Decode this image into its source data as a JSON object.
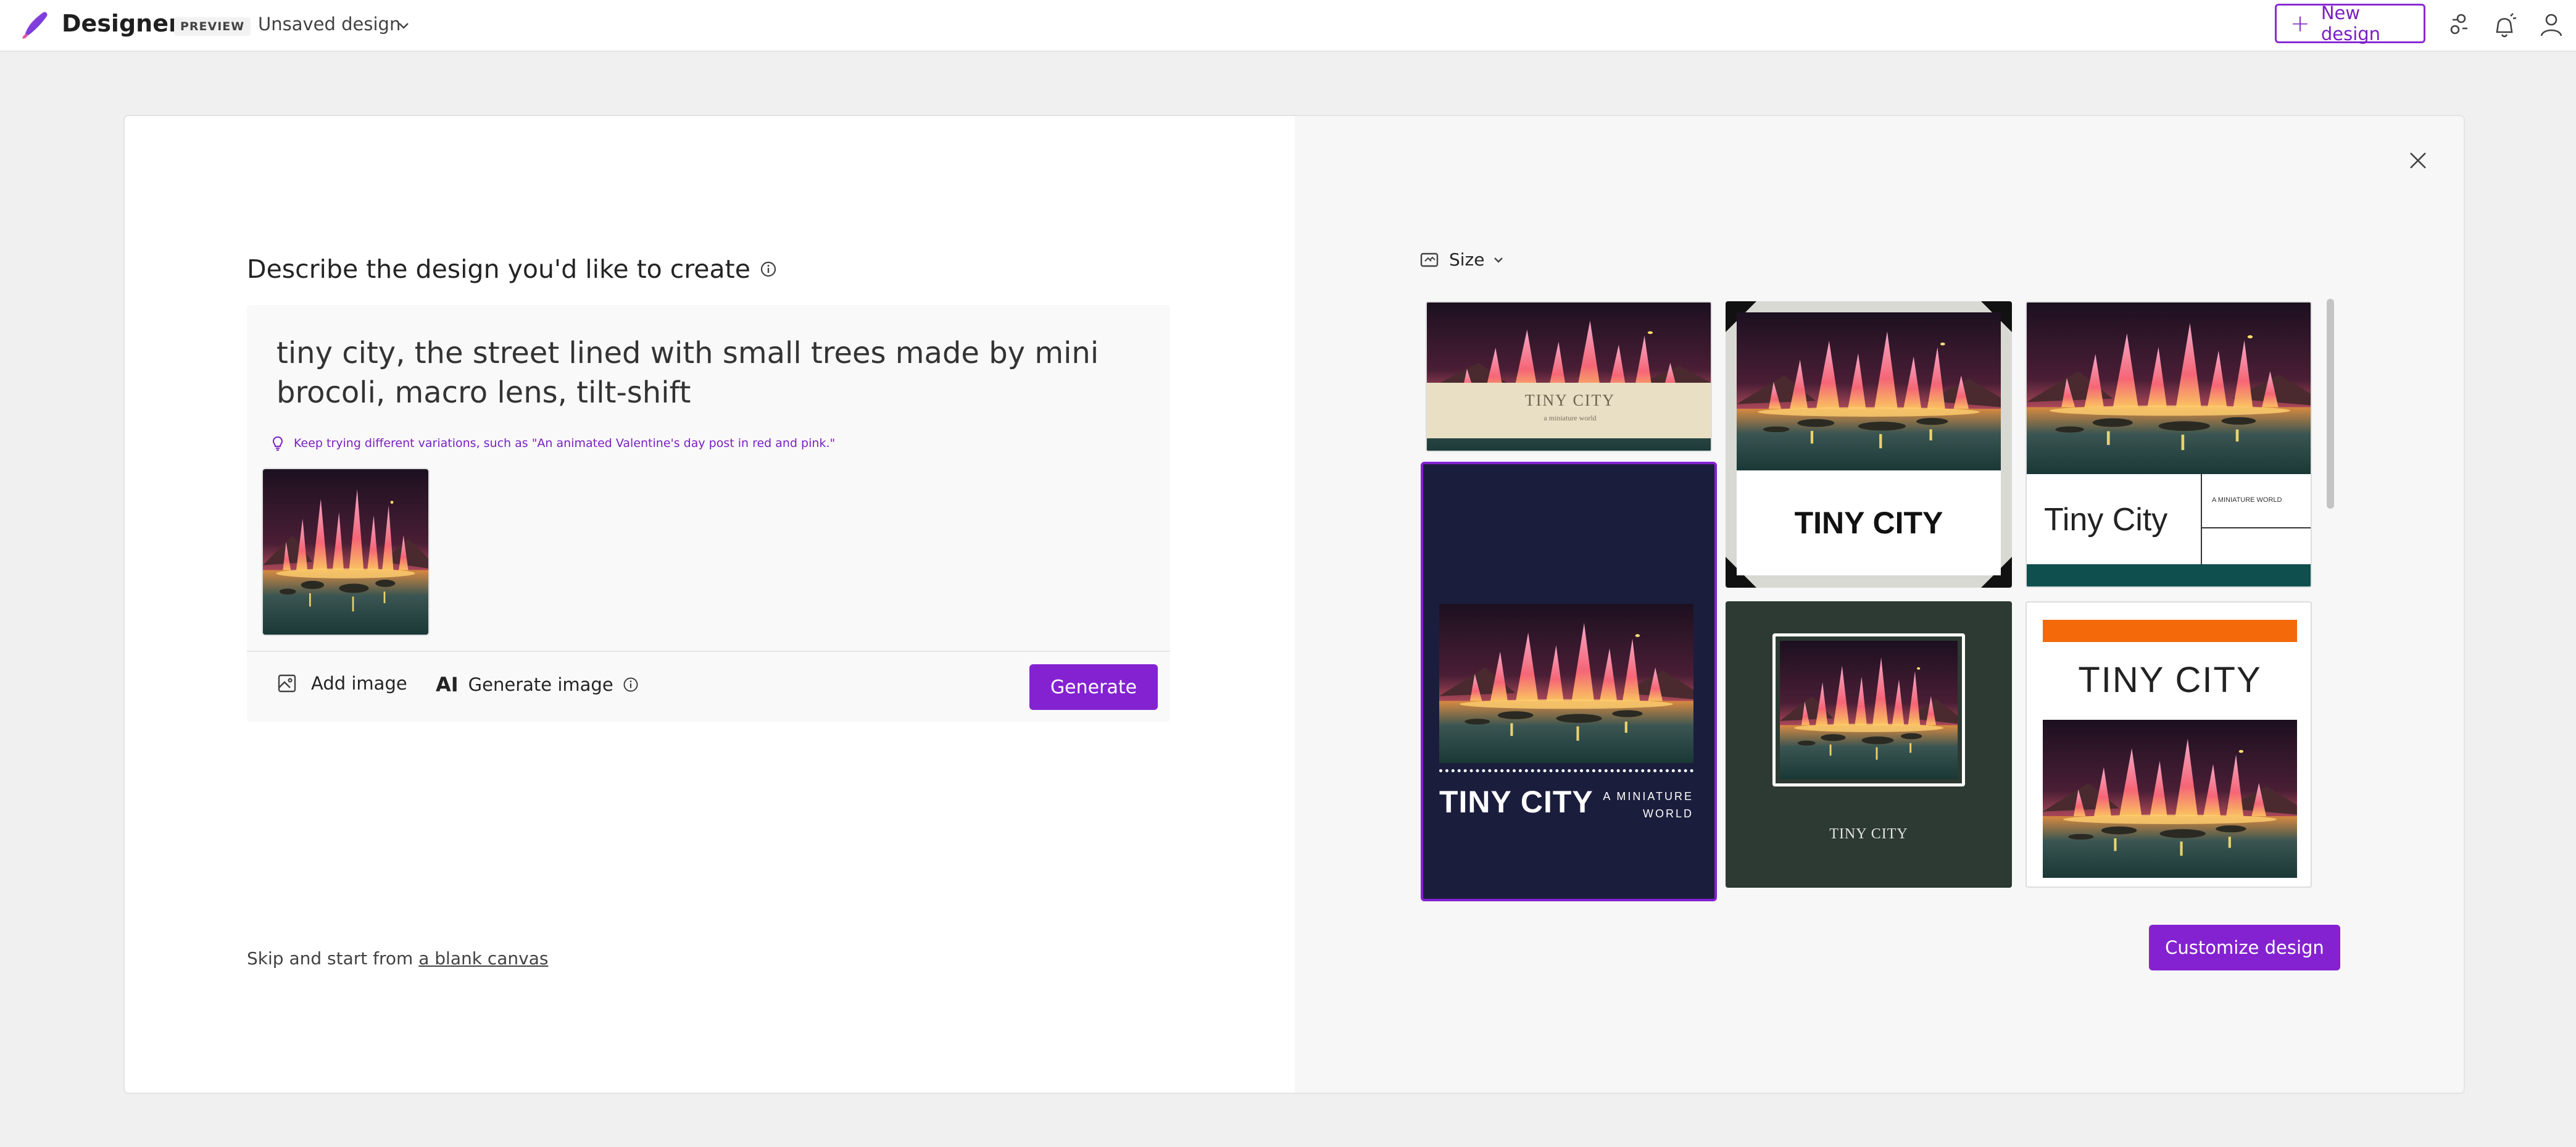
{
  "app": {
    "brand": "Designer",
    "badge": "PREVIEW",
    "document_title": "Unsaved design",
    "new_design_label": "New design"
  },
  "prompt_panel": {
    "title": "Describe the design you'd like to create",
    "prompt_text": "tiny city, the street lined with small trees made by mini brocoli, macro lens, tilt-shift",
    "tip": "Keep trying different variations, such as \"An animated Valentine's day post in red and pink.\"",
    "add_image_label": "Add image",
    "generate_image_ai": "AI",
    "generate_image_label": "Generate image",
    "generate_label": "Generate",
    "skip_text": "Skip and start from ",
    "skip_link": "a blank canvas"
  },
  "designs_panel": {
    "size_label": "Size",
    "customize_label": "Customize design",
    "templates": [
      {
        "title": "TINY CITY",
        "subtitle": "a miniature world"
      },
      {
        "title": "TINY CITY"
      },
      {
        "title": "Tiny City",
        "subtitle": "A MINIATURE WORLD"
      },
      {
        "title": "TINY CITY",
        "subtitle": "A MINIATURE WORLD"
      },
      {
        "title": "TINY CITY"
      },
      {
        "title": "TINY CITY"
      }
    ]
  },
  "colors": {
    "accent": "#8422d1",
    "navy": "#1b1d3d",
    "forest": "#2c3a33",
    "teal": "#0f4f4e",
    "orange": "#f46a0a"
  }
}
